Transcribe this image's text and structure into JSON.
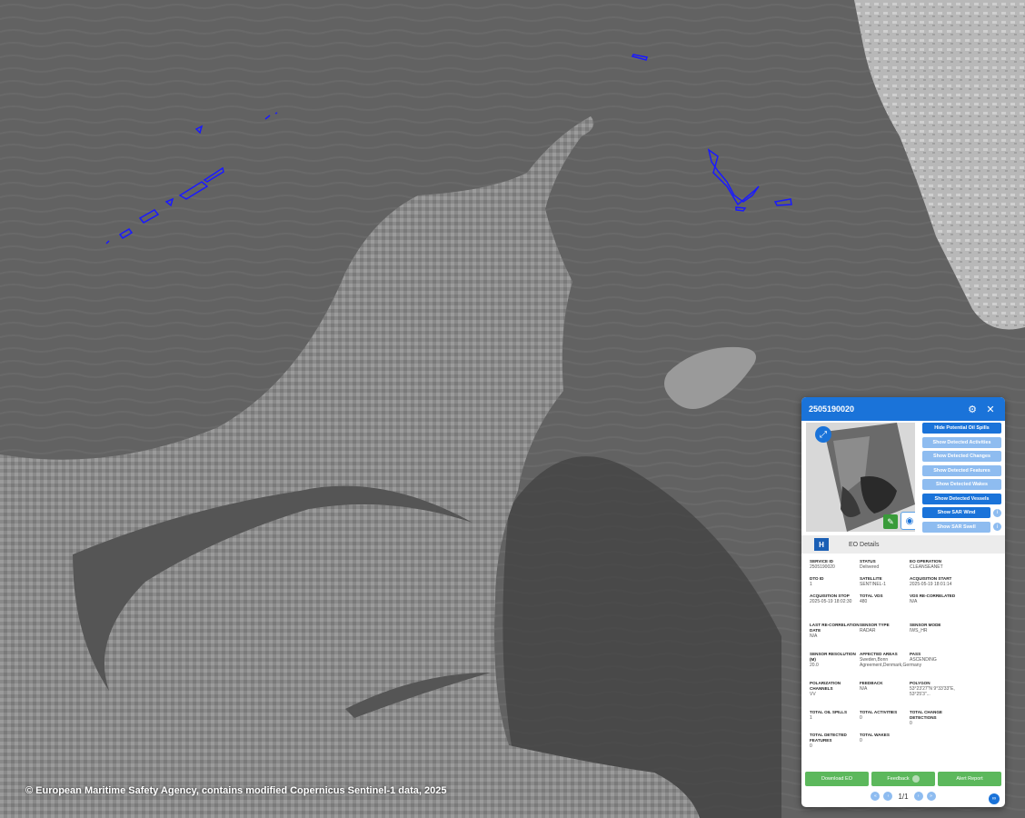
{
  "map": {
    "credit": "© European Maritime Safety Agency, contains modified Copernicus Sentinel-1 data, 2025"
  },
  "panel": {
    "title": "2505190020",
    "settings_icon": "gear-icon",
    "close_icon": "close-icon",
    "layer_buttons": [
      {
        "label": "Hide Potential Oil Spills",
        "style": "dark"
      },
      {
        "label": "Show Detected Activities",
        "style": "light"
      },
      {
        "label": "Show Detected Changes",
        "style": "light"
      },
      {
        "label": "Show Detected Features",
        "style": "light"
      },
      {
        "label": "Show Detected Wakes",
        "style": "light"
      },
      {
        "label": "Show Detected Vessels",
        "style": "dark"
      },
      {
        "label": "Show SAR Wind",
        "style": "dark",
        "info": true
      },
      {
        "label": "Show SAR Swell",
        "style": "light",
        "info": true
      }
    ],
    "section_title": "EO Details",
    "details": [
      [
        {
          "key": "SERVICE ID",
          "value": "2505190020"
        },
        {
          "key": "STATUS",
          "value": "Delivered"
        },
        {
          "key": "EO OPERATION",
          "value": "CLEANSEANET"
        }
      ],
      [
        {
          "key": "DTO ID",
          "value": "1"
        },
        {
          "key": "SATELLITE",
          "value": "SENTINEL-1"
        },
        {
          "key": "ACQUISITION START",
          "value": "2025-05-19 18:01:14"
        }
      ],
      [
        {
          "key": "ACQUISITION STOP",
          "value": "2025-05-19 18:02:30"
        },
        {
          "key": "TOTAL VDS",
          "value": "480"
        },
        {
          "key": "VDS RE-CORRELATED",
          "value": "N/A"
        }
      ],
      [
        {
          "key": "LAST RE-CORRELATION DATE",
          "value": "N/A"
        },
        {
          "key": "SENSOR TYPE",
          "value": "RADAR"
        },
        {
          "key": "SENSOR MODE",
          "value": "IWS_HR"
        }
      ],
      [
        {
          "key": "SENSOR RESOLUTION (M)",
          "value": "20.0"
        },
        {
          "key": "AFFECTED AREAS",
          "value": "Sweden,Bonn Agreement,Denmark,Germany"
        },
        {
          "key": "PASS",
          "value": "ASCENDING"
        }
      ],
      [
        {
          "key": "POLARIZATION CHANNELS",
          "value": "VV"
        },
        {
          "key": "FEEDBACK",
          "value": "N/A"
        },
        {
          "key": "POLYGON",
          "value": "53°23'27\"N 9°33'33\"E, 53°25'3\"..."
        }
      ],
      [
        {
          "key": "TOTAL OIL SPILLS",
          "value": "1"
        },
        {
          "key": "TOTAL ACTIVITIES",
          "value": "0"
        },
        {
          "key": "TOTAL CHANGE DETECTIONS",
          "value": "0"
        }
      ],
      [
        {
          "key": "TOTAL DETECTED FEATURES",
          "value": "0"
        },
        {
          "key": "TOTAL WAKES",
          "value": "0"
        },
        {
          "key": "",
          "value": ""
        }
      ]
    ],
    "actions": {
      "download": "Download EO",
      "feedback": "Feedback",
      "alert": "Alert Report"
    },
    "pager": {
      "text": "1/1"
    }
  },
  "colors": {
    "accent": "#1a73d9",
    "accent_light": "#8ebcf0",
    "action_green": "#5cb85c",
    "oil_spill_outline": "#1a1aff"
  }
}
